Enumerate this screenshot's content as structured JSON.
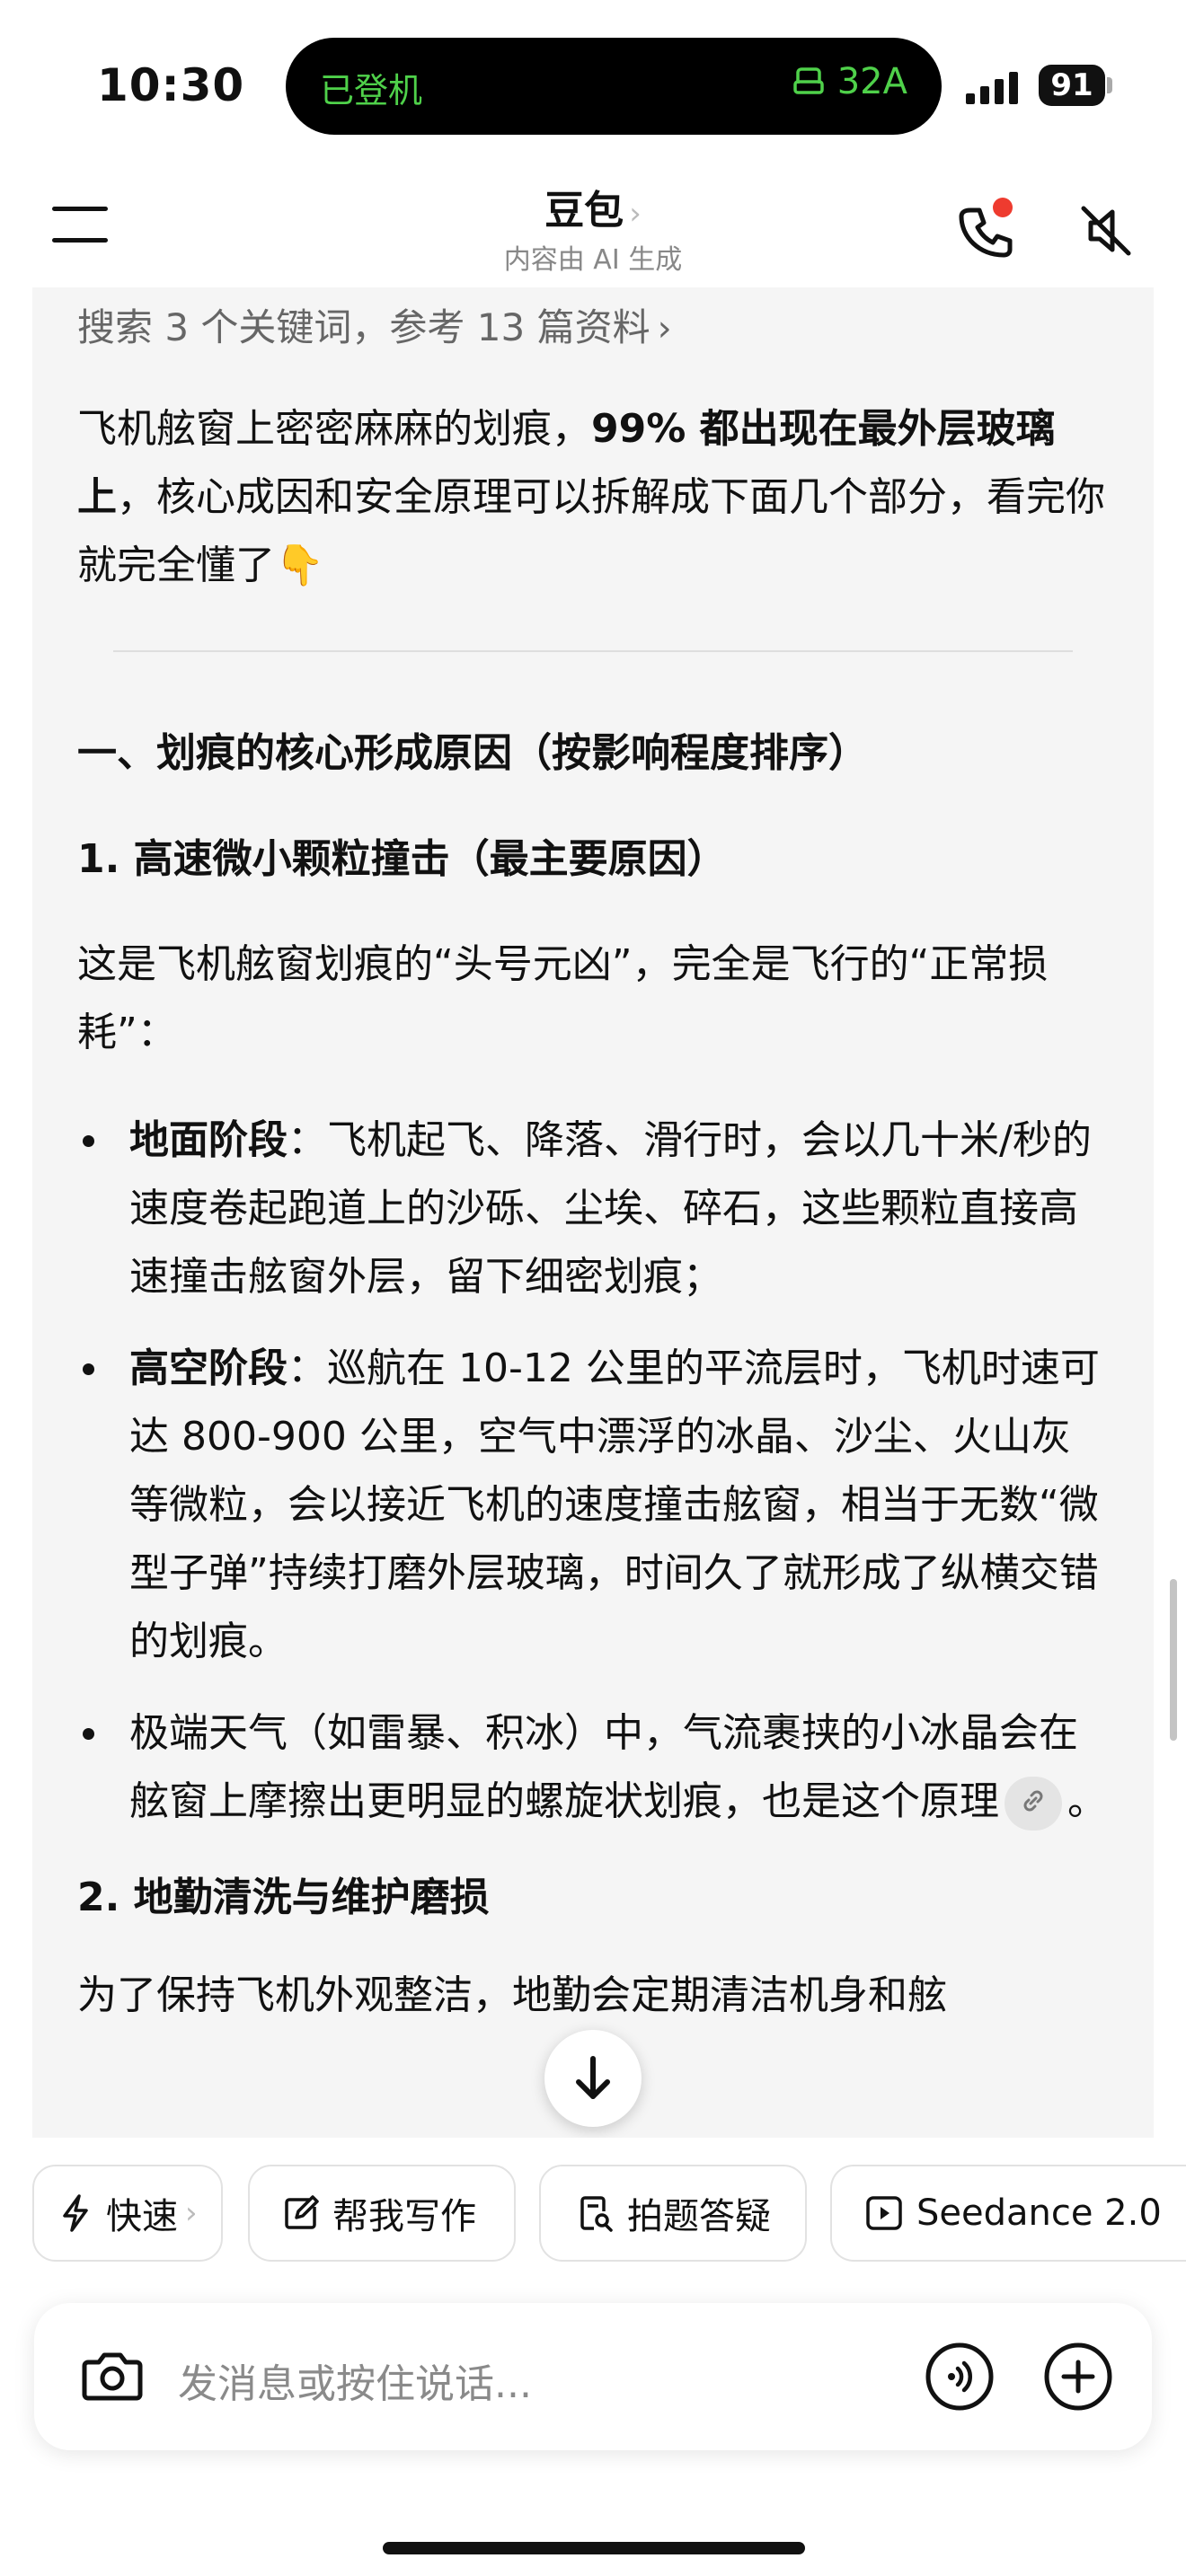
{
  "status_bar": {
    "time": "10:30",
    "island_left": "已登机",
    "island_right": "32A",
    "battery": "91"
  },
  "header": {
    "title": "豆包",
    "title_chevron": "›",
    "subtitle": "内容由 AI 生成"
  },
  "content": {
    "search_summary": "搜索 3 个关键词，参考 13 篇资料",
    "search_arrow": "›",
    "intro": {
      "part1": "飞机舷窗上密密麻麻的划痕，",
      "bold": "99% 都出现在最外层玻璃上",
      "part2": "，核心成因和安全原理可以拆解成下面几个部分，看完你就完全懂了",
      "emoji": "👇"
    },
    "section1_heading": "一、划痕的核心形成原因（按影响程度排序）",
    "sub1_heading": "1. 高速微小颗粒撞击（最主要原因）",
    "sub1_para": "这是飞机舷窗划痕的“头号元凶”，完全是飞行的“正常损耗”：",
    "bullets": [
      {
        "bold": "地面阶段",
        "text": "：飞机起飞、降落、滑行时，会以几十米/秒的速度卷起跑道上的沙砾、尘埃、碎石，这些颗粒直接高速撞击舷窗外层，留下细密划痕；"
      },
      {
        "bold": "高空阶段",
        "text": "：巡航在 10-12 公里的平流层时，飞机时速可达 800-900 公里，空气中漂浮的冰晶、沙尘、火山灰等微粒，会以接近飞机的速度撞击舷窗，相当于无数“微型子弹”持续打磨外层玻璃，时间久了就形成了纵横交错的划痕。"
      },
      {
        "bold": "",
        "text": "极端天气（如雷暴、积冰）中，气流裹挟的小冰晶会在舷窗上摩擦出更明显的螺旋状划痕，也是这个原理",
        "suffix": "。"
      }
    ],
    "sub2_heading": "2. 地勤清洗与维护磨损",
    "sub2_para_partial": "为了保持飞机外观整洁，地勤会定期清洁机身和舷"
  },
  "chips": [
    {
      "label": "快速",
      "icon": "lightning-icon",
      "chevron": "›"
    },
    {
      "label": "帮我写作",
      "icon": "edit-icon"
    },
    {
      "label": "拍题答疑",
      "icon": "scan-doc-icon"
    },
    {
      "label": "Seedance 2.0",
      "icon": "video-play-icon"
    }
  ],
  "input": {
    "placeholder": "发消息或按住说话..."
  },
  "colors": {
    "accent_green": "#4fd14a",
    "record_dot": "#ee3b2f",
    "content_bg": "#f5f5f5"
  }
}
